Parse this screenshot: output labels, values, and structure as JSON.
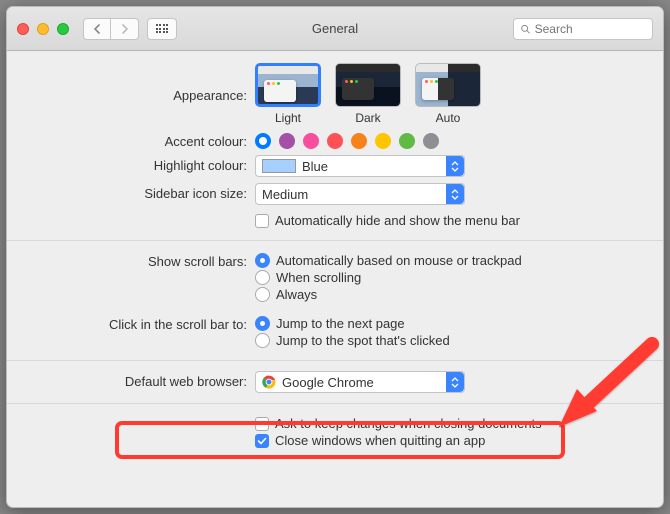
{
  "window": {
    "title": "General"
  },
  "search": {
    "placeholder": "Search"
  },
  "appearance": {
    "label": "Appearance:",
    "options": [
      {
        "name": "Light",
        "selected": true
      },
      {
        "name": "Dark",
        "selected": false
      },
      {
        "name": "Auto",
        "selected": false
      }
    ]
  },
  "accent": {
    "label": "Accent colour:",
    "colors": [
      "#007aff",
      "#a550a7",
      "#f74f9e",
      "#ff5257",
      "#f7821b",
      "#ffc600",
      "#62ba46",
      "#8e8e93"
    ],
    "selected_index": 0
  },
  "highlight": {
    "label": "Highlight colour:",
    "value": "Blue"
  },
  "sidebar_size": {
    "label": "Sidebar icon size:",
    "value": "Medium"
  },
  "menubar_autohide": {
    "label": "Automatically hide and show the menu bar",
    "checked": false
  },
  "scrollbars": {
    "label": "Show scroll bars:",
    "options": [
      {
        "label": "Automatically based on mouse or trackpad",
        "checked": true
      },
      {
        "label": "When scrolling",
        "checked": false
      },
      {
        "label": "Always",
        "checked": false
      }
    ]
  },
  "scrollclick": {
    "label": "Click in the scroll bar to:",
    "options": [
      {
        "label": "Jump to the next page",
        "checked": true
      },
      {
        "label": "Jump to the spot that's clicked",
        "checked": false
      }
    ]
  },
  "browser": {
    "label": "Default web browser:",
    "value": "Google Chrome"
  },
  "ask_changes": {
    "label": "Ask to keep changes when closing documents",
    "checked": false
  },
  "close_windows": {
    "label": "Close windows when quitting an app",
    "checked": true
  }
}
